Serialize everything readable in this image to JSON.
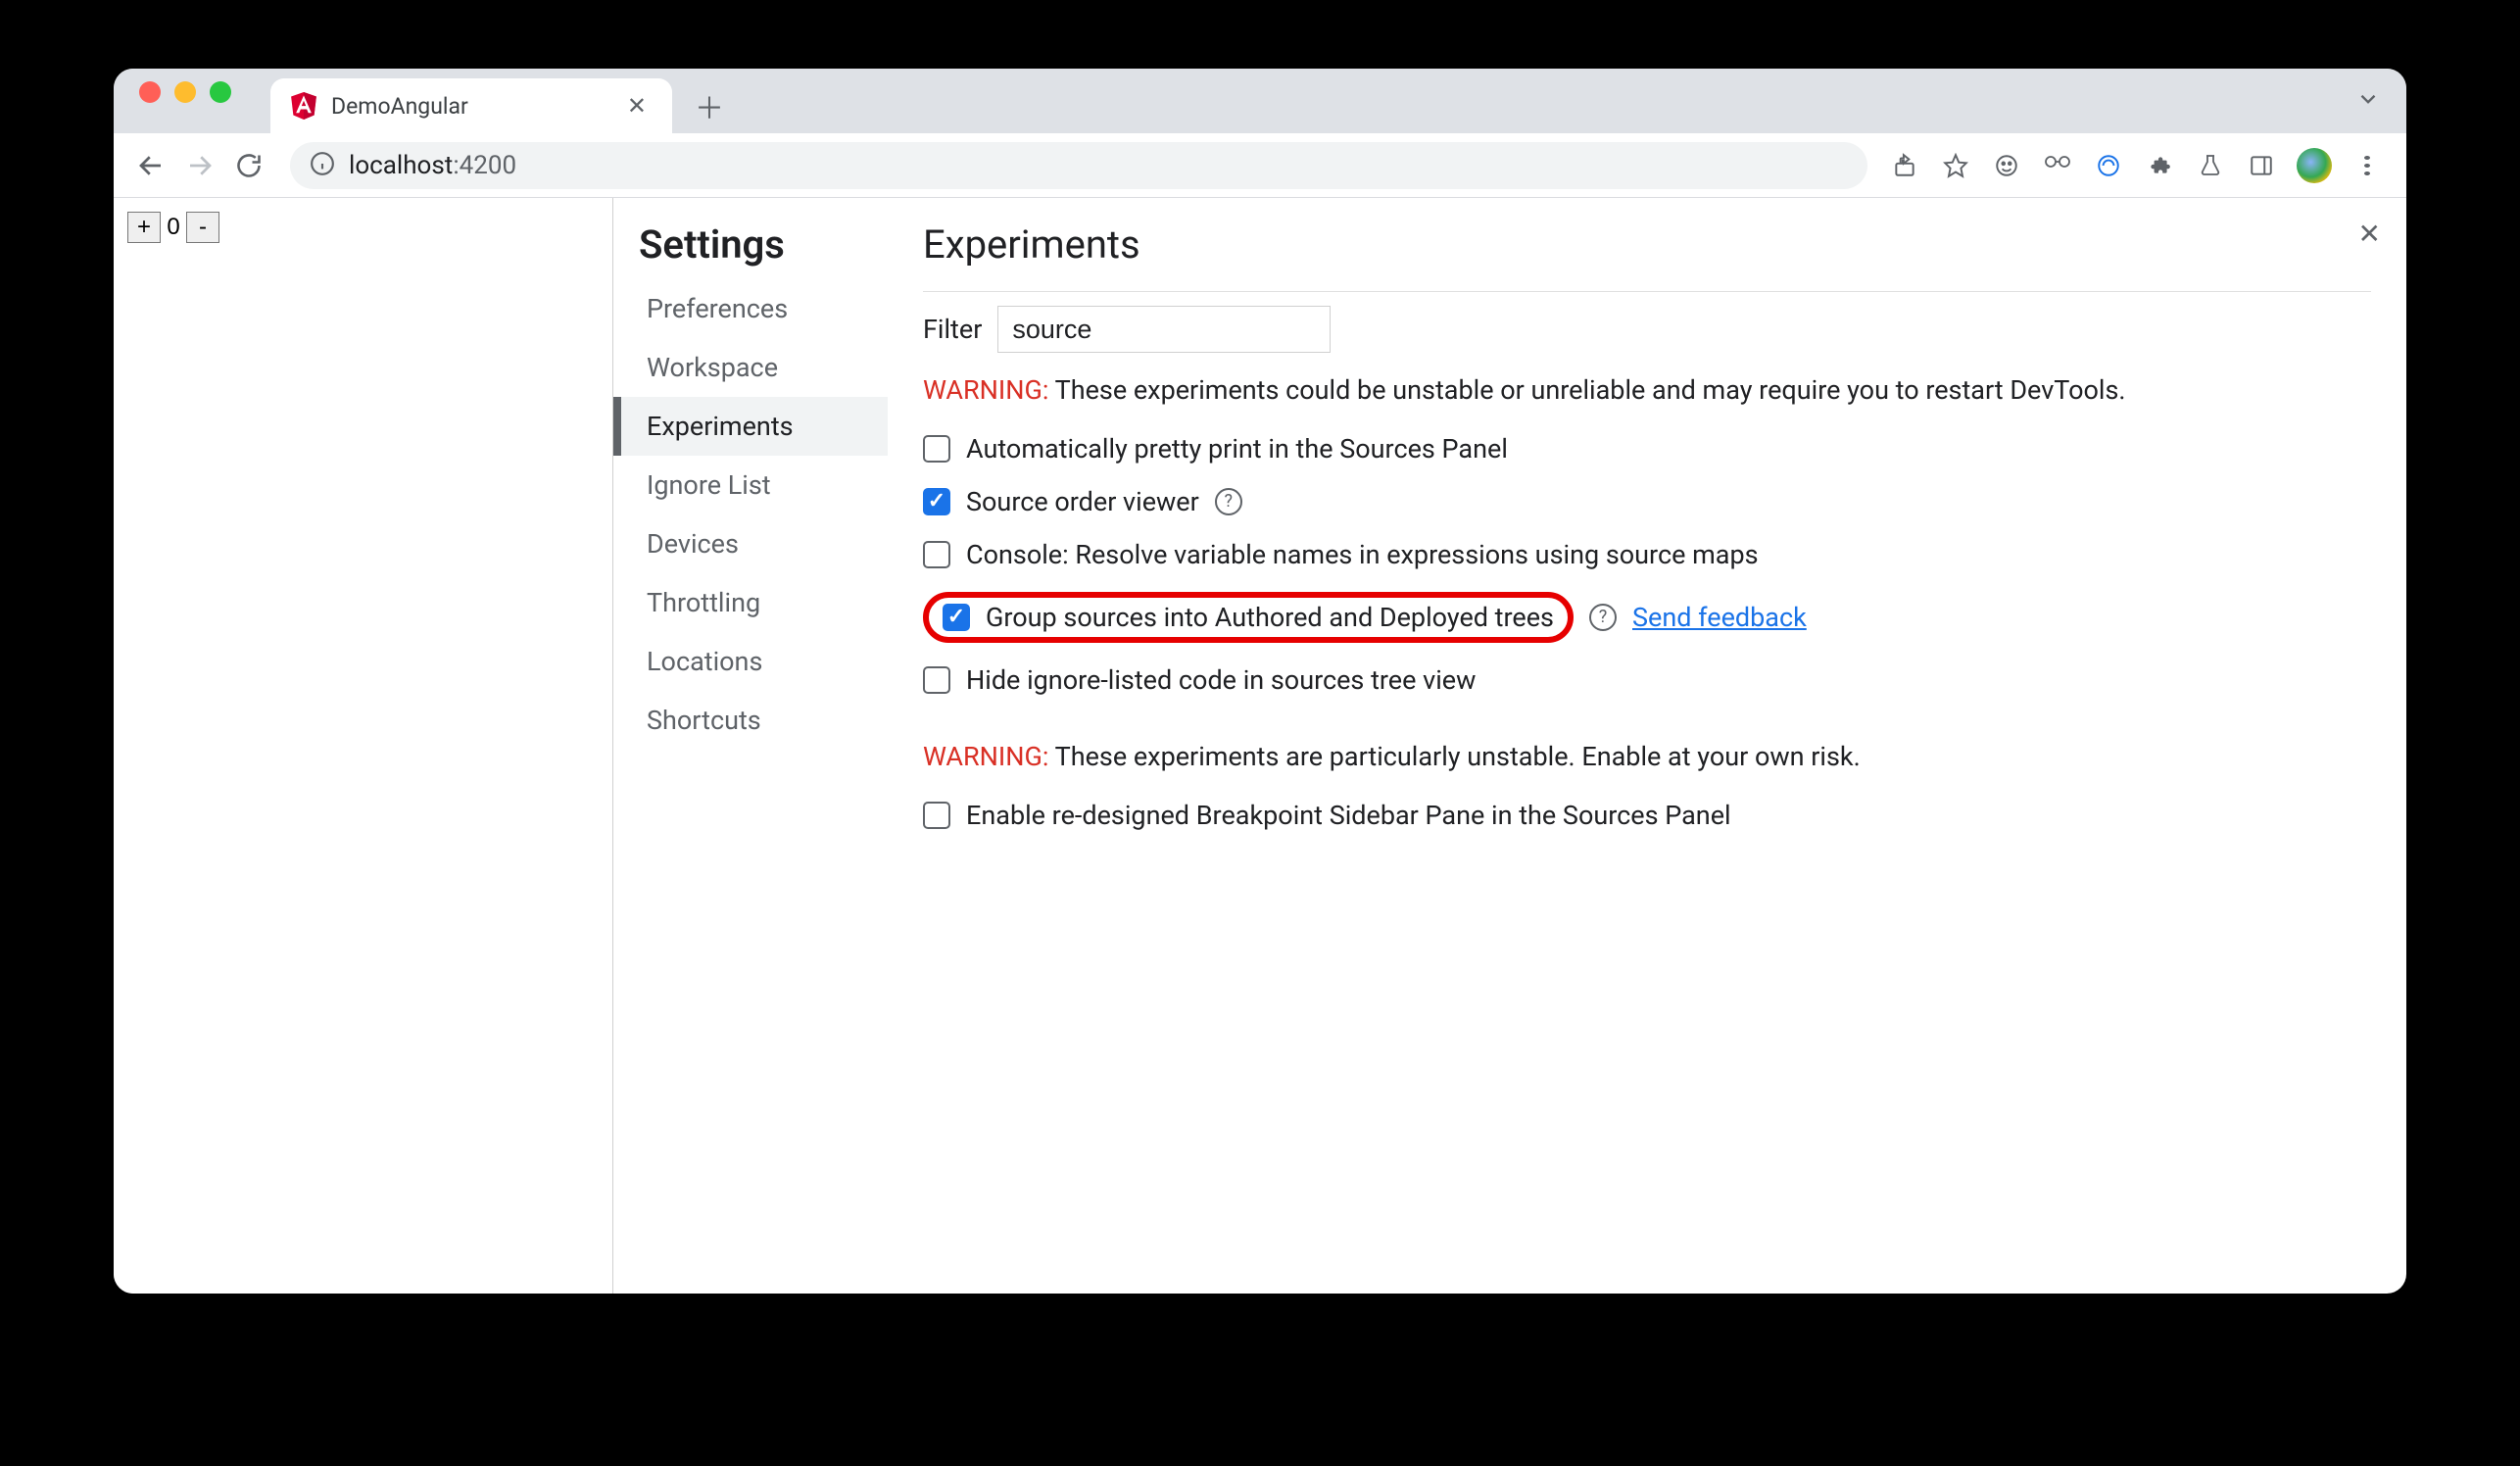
{
  "tab": {
    "title": "DemoAngular"
  },
  "url": {
    "host": "localhost",
    "port": ":4200"
  },
  "counter": {
    "value": "0"
  },
  "settings": {
    "title": "Settings",
    "nav": {
      "preferences": "Preferences",
      "workspace": "Workspace",
      "experiments": "Experiments",
      "ignore_list": "Ignore List",
      "devices": "Devices",
      "throttling": "Throttling",
      "locations": "Locations",
      "shortcuts": "Shortcuts"
    }
  },
  "experiments": {
    "title": "Experiments",
    "filter_label": "Filter",
    "filter_value": "source",
    "warning1_prefix": "WARNING:",
    "warning1_body": " These experiments could be unstable or unreliable and may require you to restart DevTools.",
    "items": {
      "pretty_print": {
        "label": "Automatically pretty print in the Sources Panel",
        "checked": false
      },
      "source_order": {
        "label": "Source order viewer",
        "checked": true
      },
      "resolve_vars": {
        "label": "Console: Resolve variable names in expressions using source maps",
        "checked": false
      },
      "group_sources": {
        "label": "Group sources into Authored and Deployed trees",
        "checked": true,
        "feedback": "Send feedback"
      },
      "hide_ignore": {
        "label": "Hide ignore-listed code in sources tree view",
        "checked": false
      }
    },
    "warning2_prefix": "WARNING:",
    "warning2_body": " These experiments are particularly unstable. Enable at your own risk.",
    "items2": {
      "breakpoint_sidebar": {
        "label": "Enable re-designed Breakpoint Sidebar Pane in the Sources Panel",
        "checked": false
      }
    }
  }
}
